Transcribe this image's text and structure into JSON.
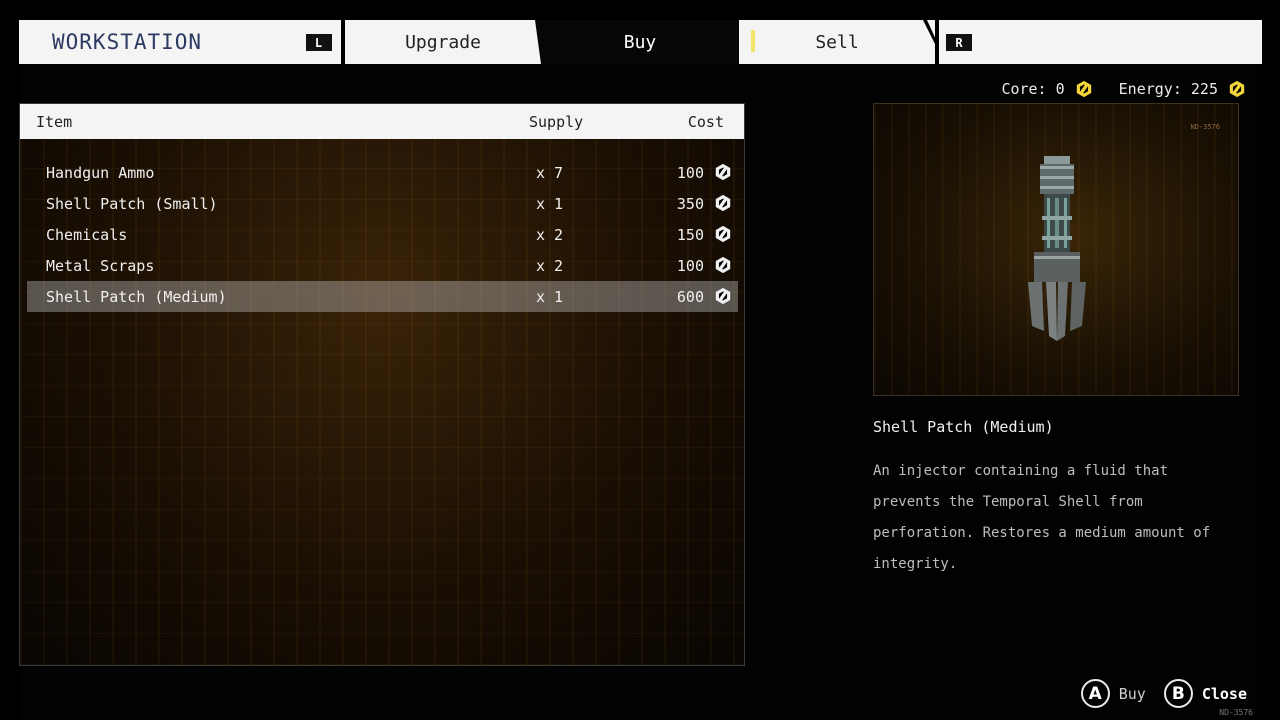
{
  "header": {
    "title": "WORKSTATION",
    "left_button": "L",
    "right_button": "R",
    "tabs": [
      {
        "label": "Upgrade",
        "active": false
      },
      {
        "label": "Buy",
        "active": true
      },
      {
        "label": "Sell",
        "active": false
      }
    ]
  },
  "currency": {
    "core_label": "Core: 0",
    "energy_label": "Energy: 225",
    "icon": "energy-coin-icon"
  },
  "list": {
    "columns": {
      "item": "Item",
      "supply": "Supply",
      "cost": "Cost"
    },
    "rows": [
      {
        "name": "Handgun Ammo",
        "supply": "x 7",
        "cost": "100"
      },
      {
        "name": "Shell Patch (Small)",
        "supply": "x 1",
        "cost": "350"
      },
      {
        "name": "Chemicals",
        "supply": "x 2",
        "cost": "150"
      },
      {
        "name": "Metal Scraps",
        "supply": "x 2",
        "cost": "100"
      },
      {
        "name": "Shell Patch (Medium)",
        "supply": "x 1",
        "cost": "600"
      }
    ],
    "selected_index": 4
  },
  "preview": {
    "code": "ND-3576",
    "item_name": "Shell Patch (Medium)",
    "description": "An injector containing a fluid that prevents the Temporal Shell from perforation. Restores a medium amount of integrity."
  },
  "prompts": {
    "buy_button": "A",
    "buy_label": "Buy",
    "close_button": "B",
    "close_label": "Close"
  },
  "footer_code": "ND-3576",
  "colors": {
    "title_blue": "#2c3a62",
    "accent_yellow": "#f3e56a",
    "panel_amber": "#3a2308"
  }
}
